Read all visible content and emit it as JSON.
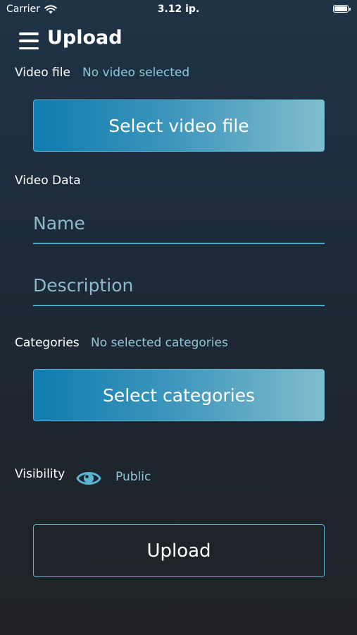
{
  "status_bar": {
    "carrier": "Carrier",
    "time": "3.12 ip.",
    "battery_level": 1.0
  },
  "header": {
    "title": "Upload"
  },
  "video_file": {
    "label": "Video file",
    "value": "No video selected",
    "button_label": "Select video file"
  },
  "video_data": {
    "label": "Video Data",
    "name_placeholder": "Name",
    "name_value": "",
    "description_placeholder": "Description",
    "description_value": ""
  },
  "categories": {
    "label": "Categories",
    "value": "No selected categories",
    "button_label": "Select categories"
  },
  "visibility": {
    "label": "Visibility",
    "value": "Public",
    "icon": "eye-icon"
  },
  "actions": {
    "upload_label": "Upload"
  },
  "colors": {
    "accent": "#5ab5d3",
    "secondary_text": "#8fc7d6",
    "button_gradient_start": "#0f7cb0",
    "button_gradient_end": "#82bccd"
  }
}
